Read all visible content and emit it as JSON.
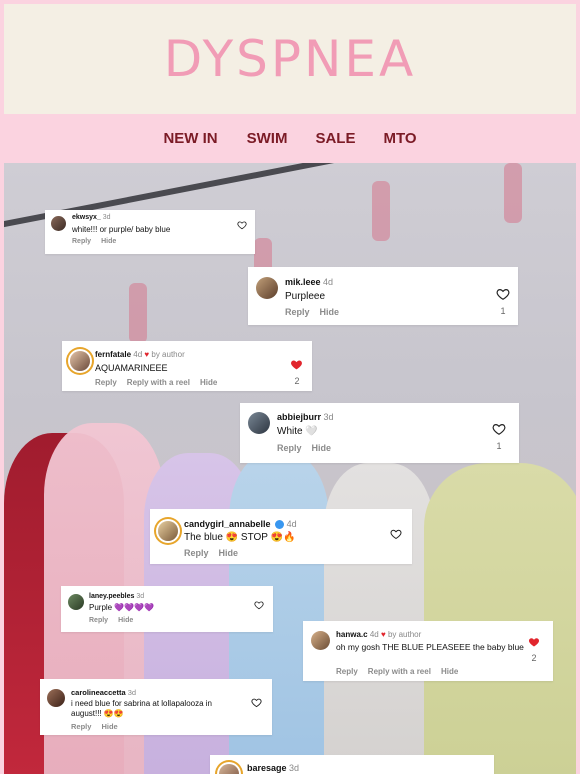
{
  "brand": {
    "logo": "DYSPNEA"
  },
  "nav": [
    "NEW IN",
    "SWIM",
    "SALE",
    "MTO"
  ],
  "colors": {
    "header_bg": "#f4efe4",
    "page_bg": "#fbd3e0",
    "logo": "#f19cb6",
    "nav_text": "#7b1b26",
    "liked": "#e1252d"
  },
  "comments": [
    {
      "user": "ekwsyx_",
      "time": "3d",
      "text": "white!!! or purple/ baby blue",
      "actions": [
        "Reply",
        "Hide"
      ],
      "liked": false
    },
    {
      "user": "mik.leee",
      "time": "4d",
      "text": "Purpleee",
      "actions": [
        "Reply",
        "Hide"
      ],
      "liked": false,
      "likes": "1"
    },
    {
      "user": "fernfatale",
      "time": "4d",
      "by_author": "by author",
      "text": "AQUAMARINEEE",
      "actions": [
        "Reply",
        "Reply with a reel",
        "Hide"
      ],
      "liked": true,
      "likes": "2"
    },
    {
      "user": "abbiejburr",
      "time": "3d",
      "text": "White 🤍",
      "actions": [
        "Reply",
        "Hide"
      ],
      "liked": false,
      "likes": "1"
    },
    {
      "user": "candygirl_annabelle",
      "time": "4d",
      "verified": true,
      "text": "The blue 😍 STOP 😍🔥",
      "actions": [
        "Reply",
        "Hide"
      ],
      "liked": false
    },
    {
      "user": "laney.peebles",
      "time": "3d",
      "text": "Purple 💜💜💜💜",
      "actions": [
        "Reply",
        "Hide"
      ],
      "liked": false
    },
    {
      "user": "hanwa.c",
      "time": "4d",
      "by_author": "by author",
      "text": "oh my gosh THE BLUE PLEASEEE the baby blue",
      "actions": [
        "Reply",
        "Reply with a reel",
        "Hide"
      ],
      "liked": true,
      "likes": "2"
    },
    {
      "user": "carolineaccetta",
      "time": "3d",
      "text": "i need blue for sabrina at lollapalooza in august!!! 😍😍",
      "actions": [
        "Reply",
        "Hide"
      ],
      "liked": false
    },
    {
      "user": "baresage",
      "time": "3d"
    }
  ]
}
